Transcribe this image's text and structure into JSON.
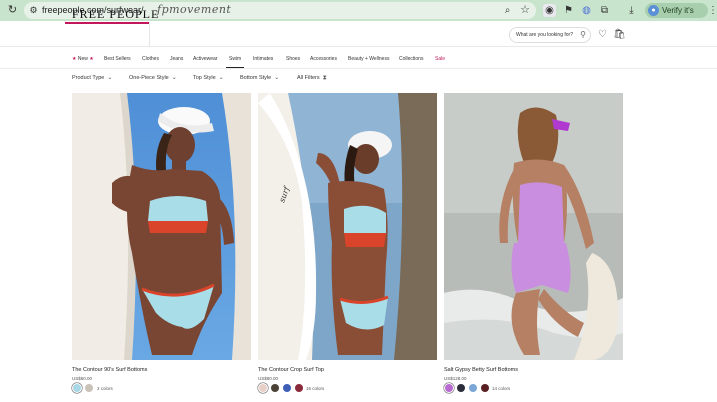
{
  "browser": {
    "url": "freepeople.com/surfwear/",
    "verify_label": "Verify it's you",
    "icons": [
      "reload-icon",
      "tune-icon",
      "zoom-icon",
      "star-icon",
      "extension-icon",
      "download-icon",
      "profile-icon"
    ]
  },
  "header": {
    "brand": "FREE PEOPLE",
    "secondary_brand": "fpmovement",
    "search_placeholder": "What are you looking for?",
    "accent_color": "#c2185b"
  },
  "nav": {
    "items": [
      {
        "label": "★ New ★"
      },
      {
        "label": "Best Sellers"
      },
      {
        "label": "Clothes"
      },
      {
        "label": "Jeans"
      },
      {
        "label": "Activewear"
      },
      {
        "label": "Swim"
      },
      {
        "label": "Intimates"
      },
      {
        "label": "Shoes"
      },
      {
        "label": "Accessories"
      },
      {
        "label": "Beauty + Wellness"
      },
      {
        "label": "Collections"
      },
      {
        "label": "Sale"
      }
    ],
    "new_star": "★",
    "new_text": "New",
    "active": "Swim"
  },
  "filters": {
    "items": [
      {
        "label": "Product Type"
      },
      {
        "label": "One-Piece Style"
      },
      {
        "label": "Top Style"
      },
      {
        "label": "Bottom Style"
      },
      {
        "label": "All Filters"
      }
    ]
  },
  "products": [
    {
      "name": "The Contour 90's Surf Bottoms",
      "price": "US$60.00",
      "colors_label": "2 colors",
      "swatches": [
        "#a8d8e6",
        "#c9c2b8"
      ]
    },
    {
      "name": "The Contour Crop Surf Top",
      "price": "US$80.00",
      "colors_label": "16 colors",
      "swatches": [
        "#e8d0c8",
        "#4a4237",
        "#3f5fb6",
        "#8a2a3a"
      ]
    },
    {
      "name": "Salt Gypsy Betty Surf Bottoms",
      "price": "US$128.00",
      "colors_label": "14 colors",
      "swatches": [
        "#b86ad0",
        "#2b2e3a",
        "#7aa7d6",
        "#5a1f22"
      ]
    }
  ]
}
